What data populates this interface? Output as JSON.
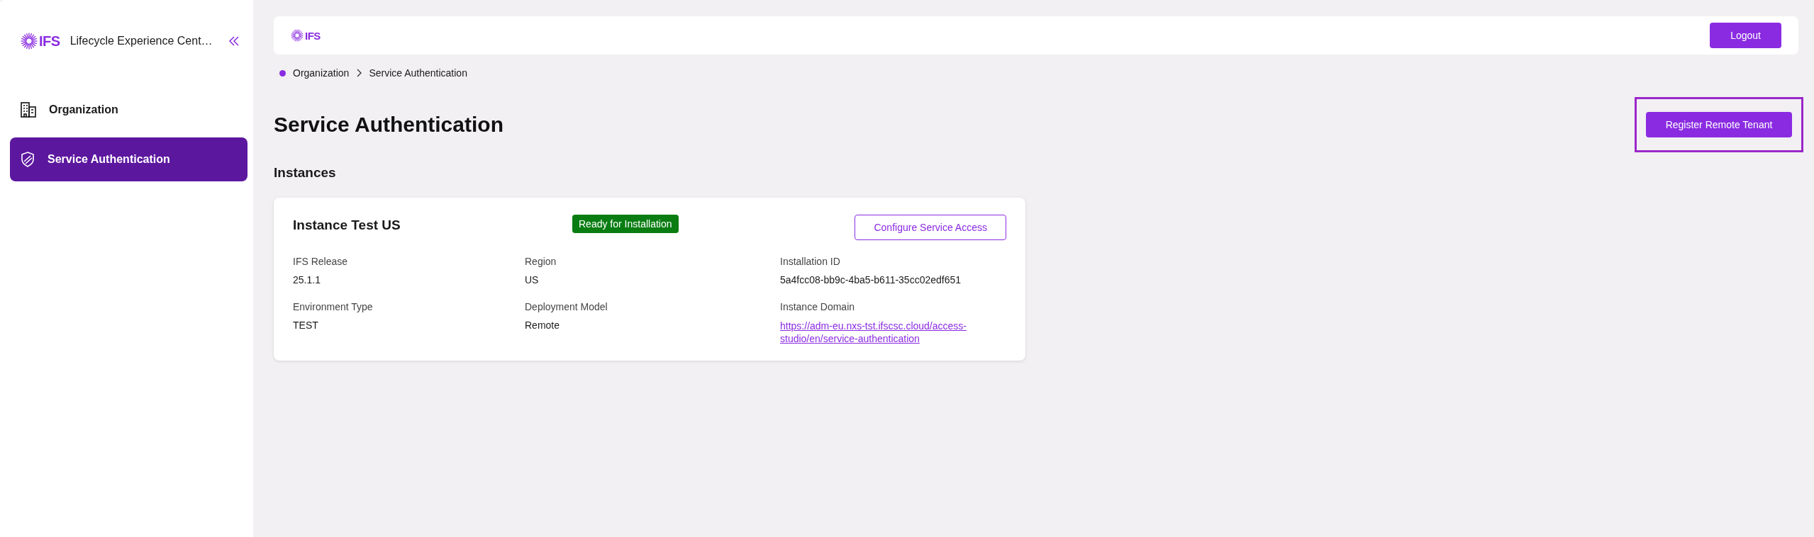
{
  "sidebar": {
    "logo_text": "IFS",
    "app_title": "Lifecycle Experience Cent…",
    "items": [
      {
        "label": "Organization",
        "kind": "building",
        "selected": false
      },
      {
        "label": "Service Authentication",
        "kind": "shield",
        "selected": true
      }
    ]
  },
  "header": {
    "logo_text": "IFS",
    "logout": "Logout"
  },
  "breadcrumb": [
    "Organization",
    "Service Authentication"
  ],
  "page_title": "Service Authentication",
  "register_button": {
    "label": "Register Remote Tenant",
    "highlighted": true
  },
  "section_title": "Instances",
  "instances": [
    {
      "name": "Instance Test US",
      "status": "Ready for Installation",
      "action": "Configure Service Access",
      "fields": [
        {
          "label": "IFS Release",
          "value": "25.1.1",
          "kind": "text"
        },
        {
          "label": "Region",
          "value": "US",
          "kind": "text"
        },
        {
          "label": "Installation ID",
          "value": "5a4fcc08-bb9c-4ba5-b611-35cc02edf651",
          "kind": "text"
        },
        {
          "label": "Environment Type",
          "value": "TEST",
          "kind": "text"
        },
        {
          "label": "Deployment Model",
          "value": "Remote",
          "kind": "text"
        },
        {
          "label": "Instance Domain",
          "value": "https://adm-eu.nxs-tst.ifscsc.cloud/access-studio/en/service-authentication",
          "kind": "link"
        }
      ]
    }
  ]
}
